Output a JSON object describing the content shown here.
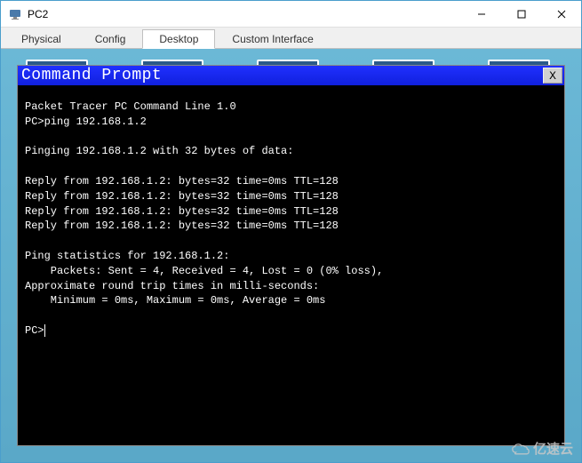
{
  "window": {
    "title": "PC2"
  },
  "tabs": {
    "items": [
      {
        "label": "Physical",
        "active": false
      },
      {
        "label": "Config",
        "active": false
      },
      {
        "label": "Desktop",
        "active": true
      },
      {
        "label": "Custom Interface",
        "active": false
      }
    ]
  },
  "terminal": {
    "title": "Command Prompt",
    "close_label": "X",
    "banner": "Packet Tracer PC Command Line 1.0",
    "command": "PC>ping 192.168.1.2",
    "pinging": "Pinging 192.168.1.2 with 32 bytes of data:",
    "replies": [
      "Reply from 192.168.1.2: bytes=32 time=0ms TTL=128",
      "Reply from 192.168.1.2: bytes=32 time=0ms TTL=128",
      "Reply from 192.168.1.2: bytes=32 time=0ms TTL=128",
      "Reply from 192.168.1.2: bytes=32 time=0ms TTL=128"
    ],
    "stats_header": "Ping statistics for 192.168.1.2:",
    "packets": "    Packets: Sent = 4, Received = 4, Lost = 0 (0% loss),",
    "rtt_header": "Approximate round trip times in milli-seconds:",
    "rtt": "    Minimum = 0ms, Maximum = 0ms, Average = 0ms",
    "prompt": "PC>"
  },
  "watermark": {
    "text": "亿速云"
  }
}
